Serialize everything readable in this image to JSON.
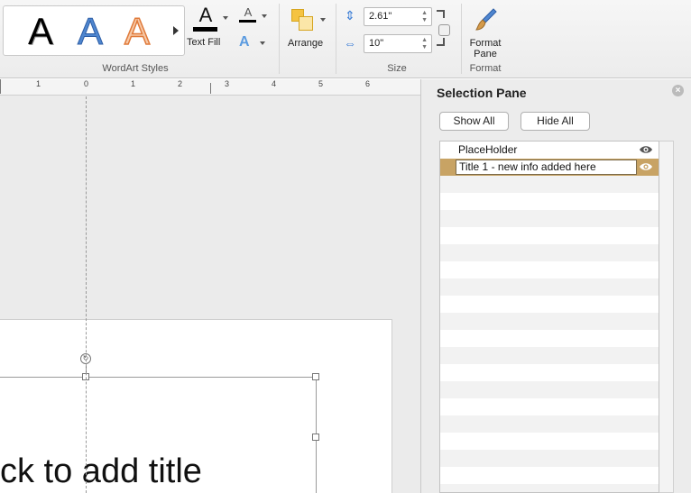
{
  "ribbon": {
    "wordart": {
      "gallery": [
        "A",
        "A",
        "A"
      ],
      "group_label": "WordArt Styles"
    },
    "text_fill": {
      "glyph": "A",
      "label": "Text Fill"
    },
    "text_outline": {
      "glyph": "A"
    },
    "text_effects": {
      "glyph": "A"
    },
    "arrange": {
      "label": "Arrange"
    },
    "size": {
      "height_value": "2.61\"",
      "width_value": "10\"",
      "group_label": "Size"
    },
    "format": {
      "label_line1": "Format",
      "label_line2": "Pane",
      "group_label": "Format"
    }
  },
  "ruler": {
    "labels": [
      "1",
      "0",
      "1",
      "2",
      "3",
      "4",
      "5",
      "6"
    ]
  },
  "slide": {
    "title_placeholder": "ck to add title"
  },
  "selection_pane": {
    "title": "Selection Pane",
    "show_all_label": "Show All",
    "hide_all_label": "Hide All",
    "items": [
      {
        "label": "PlaceHolder",
        "visible": true,
        "selected": false
      },
      {
        "label": "Title 1 - new info added here",
        "visible": true,
        "selected": true,
        "editing": true
      }
    ]
  },
  "colors": {
    "selected_row": "#c8a364",
    "accent_blue": "#3c7ed6"
  }
}
